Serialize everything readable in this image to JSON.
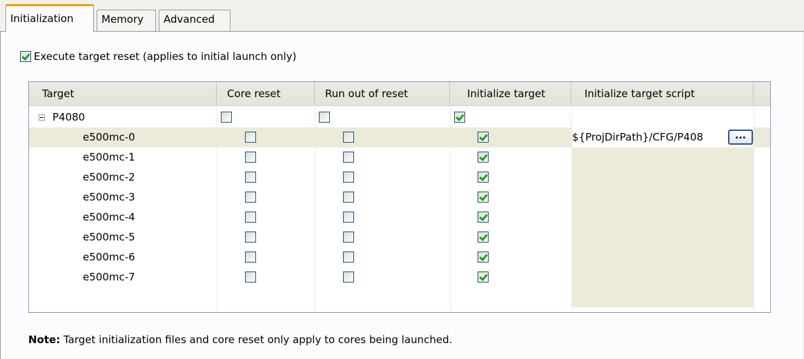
{
  "tabs": [
    {
      "label": "Initialization",
      "active": true
    },
    {
      "label": "Memory",
      "active": false
    },
    {
      "label": "Advanced",
      "active": false
    }
  ],
  "reset": {
    "label": "Execute target reset (applies to initial launch only)",
    "checked": true
  },
  "table": {
    "columns": [
      "Target",
      "Core reset",
      "Run out of reset",
      "Initialize target",
      "Initialize target script"
    ],
    "parent": {
      "name": "P4080",
      "core_reset": false,
      "run_out": false,
      "init": true,
      "script": ""
    },
    "rows": [
      {
        "name": "e500mc-0",
        "core_reset": false,
        "run_out": false,
        "init": true,
        "script": "${ProjDirPath}/CFG/P408",
        "selected": true
      },
      {
        "name": "e500mc-1",
        "core_reset": false,
        "run_out": false,
        "init": true,
        "script": ""
      },
      {
        "name": "e500mc-2",
        "core_reset": false,
        "run_out": false,
        "init": true,
        "script": ""
      },
      {
        "name": "e500mc-3",
        "core_reset": false,
        "run_out": false,
        "init": true,
        "script": ""
      },
      {
        "name": "e500mc-4",
        "core_reset": false,
        "run_out": false,
        "init": true,
        "script": ""
      },
      {
        "name": "e500mc-5",
        "core_reset": false,
        "run_out": false,
        "init": true,
        "script": ""
      },
      {
        "name": "e500mc-6",
        "core_reset": false,
        "run_out": false,
        "init": true,
        "script": ""
      },
      {
        "name": "e500mc-7",
        "core_reset": false,
        "run_out": false,
        "init": true,
        "script": ""
      }
    ],
    "browse_label": "..."
  },
  "note": {
    "bold": "Note:",
    "text": " Target initialization files and core reset only apply to cores being launched."
  }
}
